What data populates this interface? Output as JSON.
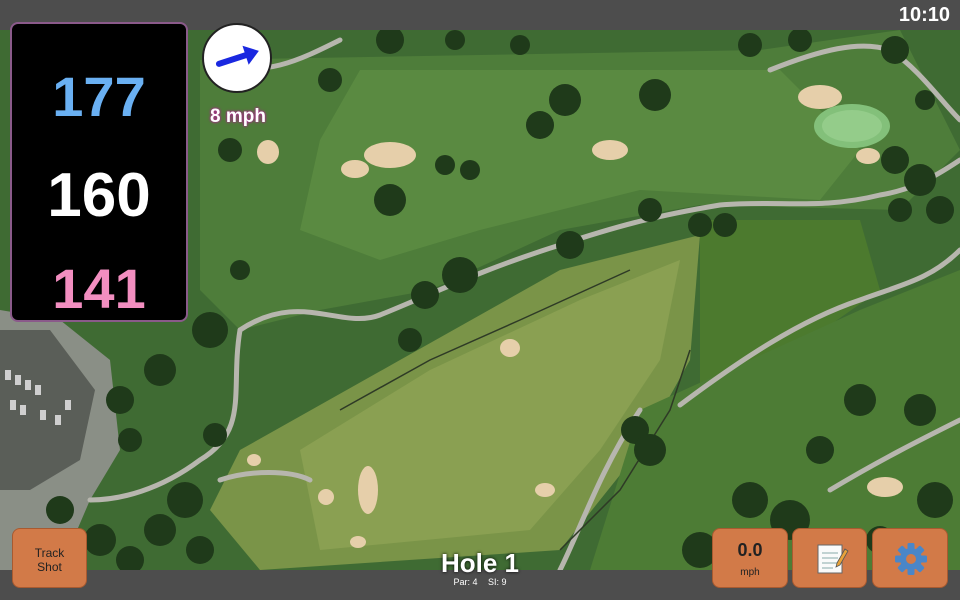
{
  "status": {
    "time": "10:10"
  },
  "yardages": {
    "back": "177",
    "middle": "160",
    "front": "141"
  },
  "wind": {
    "speed_label": "8 mph",
    "arrow_icon": "wind-arrow-icon"
  },
  "buttons": {
    "track_shot_line1": "Track",
    "track_shot_line2": "Shot",
    "speed_value": "0.0",
    "speed_unit": "mph",
    "notes_icon": "notepad-icon",
    "settings_icon": "gear-icon"
  },
  "hole": {
    "title": "Hole 1",
    "par": "Par: 4",
    "si": "SI: 9"
  },
  "colors": {
    "back_yardage": "#6ab0f2",
    "middle_yardage": "#ffffff",
    "front_yardage": "#f28ec0",
    "button_bg": "#d27a48",
    "wind_label_glow": "#b02090"
  }
}
